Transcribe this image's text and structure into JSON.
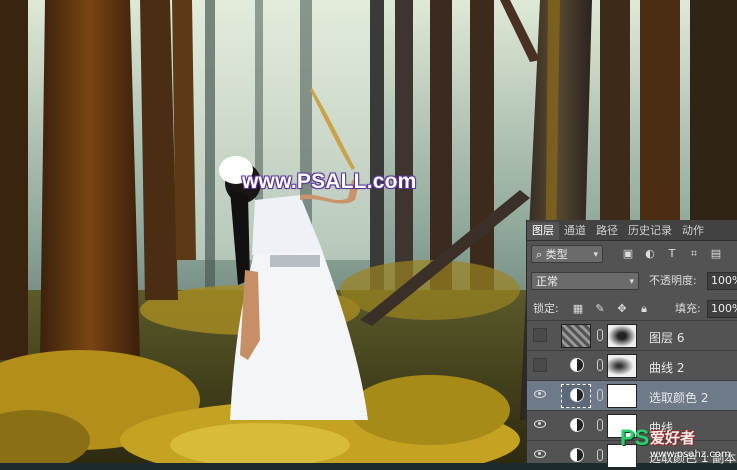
{
  "watermark": "www.PSALL.com",
  "panel": {
    "tabs": [
      "图层",
      "通道",
      "路径",
      "历史记录",
      "动作"
    ],
    "active_tab": "图层",
    "filter_label": "类型",
    "blend_mode": "正常",
    "opacity_label": "不透明度:",
    "opacity_value": "100%",
    "lock_label": "锁定:",
    "fill_label": "填充:",
    "fill_value": "100%",
    "layers": [
      {
        "name": "图层 6",
        "visible": false,
        "selected": false
      },
      {
        "name": "曲线 2",
        "visible": false,
        "selected": false
      },
      {
        "name": "选取颜色 2",
        "visible": true,
        "selected": true
      },
      {
        "name": "曲线",
        "visible": true,
        "selected": false
      },
      {
        "name": "选取颜色 1 副本",
        "visible": true,
        "selected": false
      }
    ]
  },
  "logo": {
    "ps": "PS",
    "text": "爱好者",
    "site": "www.psahz.com"
  },
  "colors": {
    "panel_bg": "#535353",
    "selected_row": "#6e7a8a",
    "foliage": "#b89a1e"
  }
}
